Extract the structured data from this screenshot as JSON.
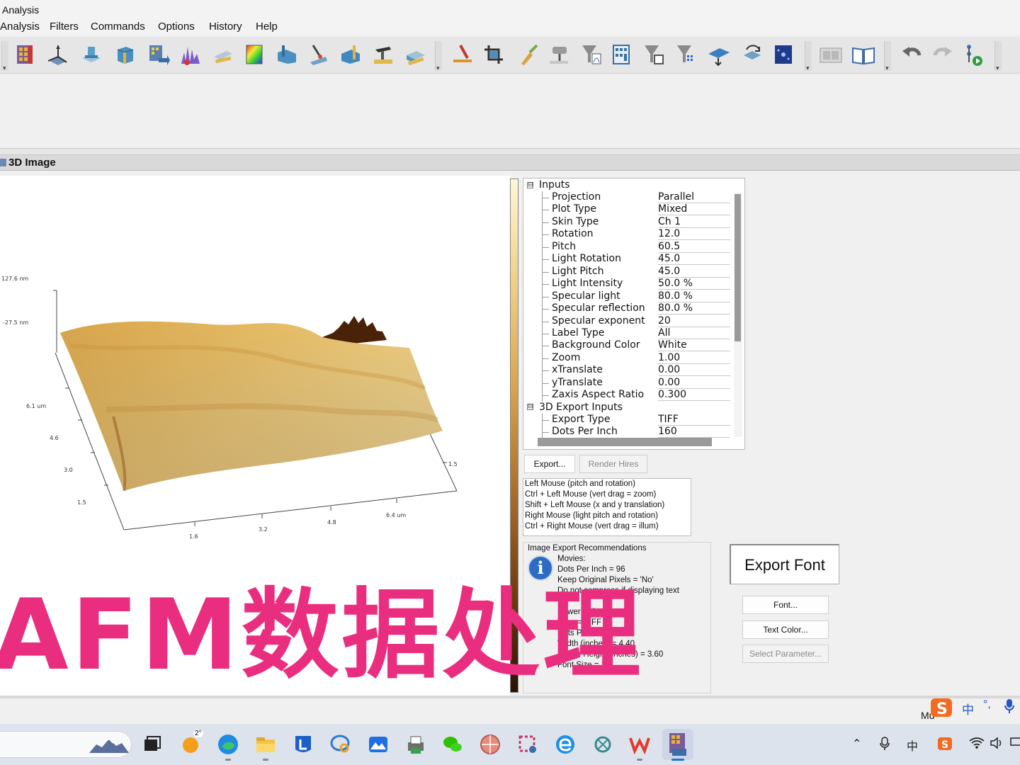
{
  "window": {
    "title": "Analysis"
  },
  "menu": [
    "Analysis",
    "Filters",
    "Commands",
    "Options",
    "History",
    "Help"
  ],
  "panel": {
    "title": "3D Image"
  },
  "plot": {
    "z_labels": [
      "127.6 nm",
      "-27.5 nm"
    ],
    "y_axis_ticks": [
      "6.1 um",
      "4.6",
      "3.0",
      "1.5"
    ],
    "x_axis_ticks": [
      "1.6",
      "3.2",
      "4.8",
      "6.4 um"
    ],
    "x_axis_side_tick": "1.5"
  },
  "properties": {
    "groups": [
      {
        "name": "Inputs",
        "expanded_glyph": "⊟",
        "items": [
          {
            "name": "Projection",
            "value": "Parallel"
          },
          {
            "name": "Plot Type",
            "value": "Mixed"
          },
          {
            "name": "Skin Type",
            "value": "Ch 1"
          },
          {
            "name": "Rotation",
            "value": "12.0"
          },
          {
            "name": "Pitch",
            "value": "60.5"
          },
          {
            "name": "Light Rotation",
            "value": "45.0"
          },
          {
            "name": "Light Pitch",
            "value": "45.0"
          },
          {
            "name": "Light Intensity",
            "value": "50.0 %"
          },
          {
            "name": "Specular light",
            "value": "80.0 %"
          },
          {
            "name": "Specular reflection",
            "value": "80.0 %"
          },
          {
            "name": "Specular exponent",
            "value": "20"
          },
          {
            "name": "Label Type",
            "value": "All"
          },
          {
            "name": "Background Color",
            "value": "White"
          },
          {
            "name": "Zoom",
            "value": "1.00"
          },
          {
            "name": "xTranslate",
            "value": "0.00"
          },
          {
            "name": "yTranslate",
            "value": "0.00"
          },
          {
            "name": "Zaxis Aspect Ratio",
            "value": "0.300"
          }
        ]
      },
      {
        "name": "3D Export Inputs",
        "expanded_glyph": "⊟",
        "items": [
          {
            "name": "Export Type",
            "value": "TIFF"
          },
          {
            "name": "Dots Per Inch",
            "value": "160"
          }
        ]
      }
    ]
  },
  "buttons": {
    "export": "Export...",
    "render_hires": "Render Hires",
    "font": "Font...",
    "text_color": "Text Color...",
    "select_parameter": "Select Parameter..."
  },
  "help_lines": [
    "Left Mouse (pitch and rotation)",
    "Ctrl + Left Mouse (vert drag = zoom)",
    "Shift + Left Mouse (x and y translation)",
    "Right Mouse (light pitch and rotation)",
    "Ctrl + Right Mouse (vert drag = illum)"
  ],
  "recommendations": {
    "title": "Image Export Recommendations",
    "lines": [
      "Movies:",
      "Dots Per Inch = 96",
      "Keep Original Pixels = 'No'",
      "Do not compress if displaying text",
      "",
      "Power Point:",
      "Type = TIFF",
      "Dots Per Inch = 160",
      "Width (inches) = 4.40",
      "Frame Height (inches) = 3.60",
      "Font Size = 14"
    ]
  },
  "export_font_label": "Export Font",
  "caption": "AFM数据处理",
  "status_text": "Mu",
  "taskbar": {
    "weather_badge": "2°",
    "tray": {
      "ime": "中",
      "punct": "°,",
      "lang": "中"
    }
  },
  "colors": {
    "caption": "#ea2e7f",
    "accent": "#2d6bc4",
    "surface_light": "#f2d48c",
    "surface_dark": "#8a5318"
  }
}
